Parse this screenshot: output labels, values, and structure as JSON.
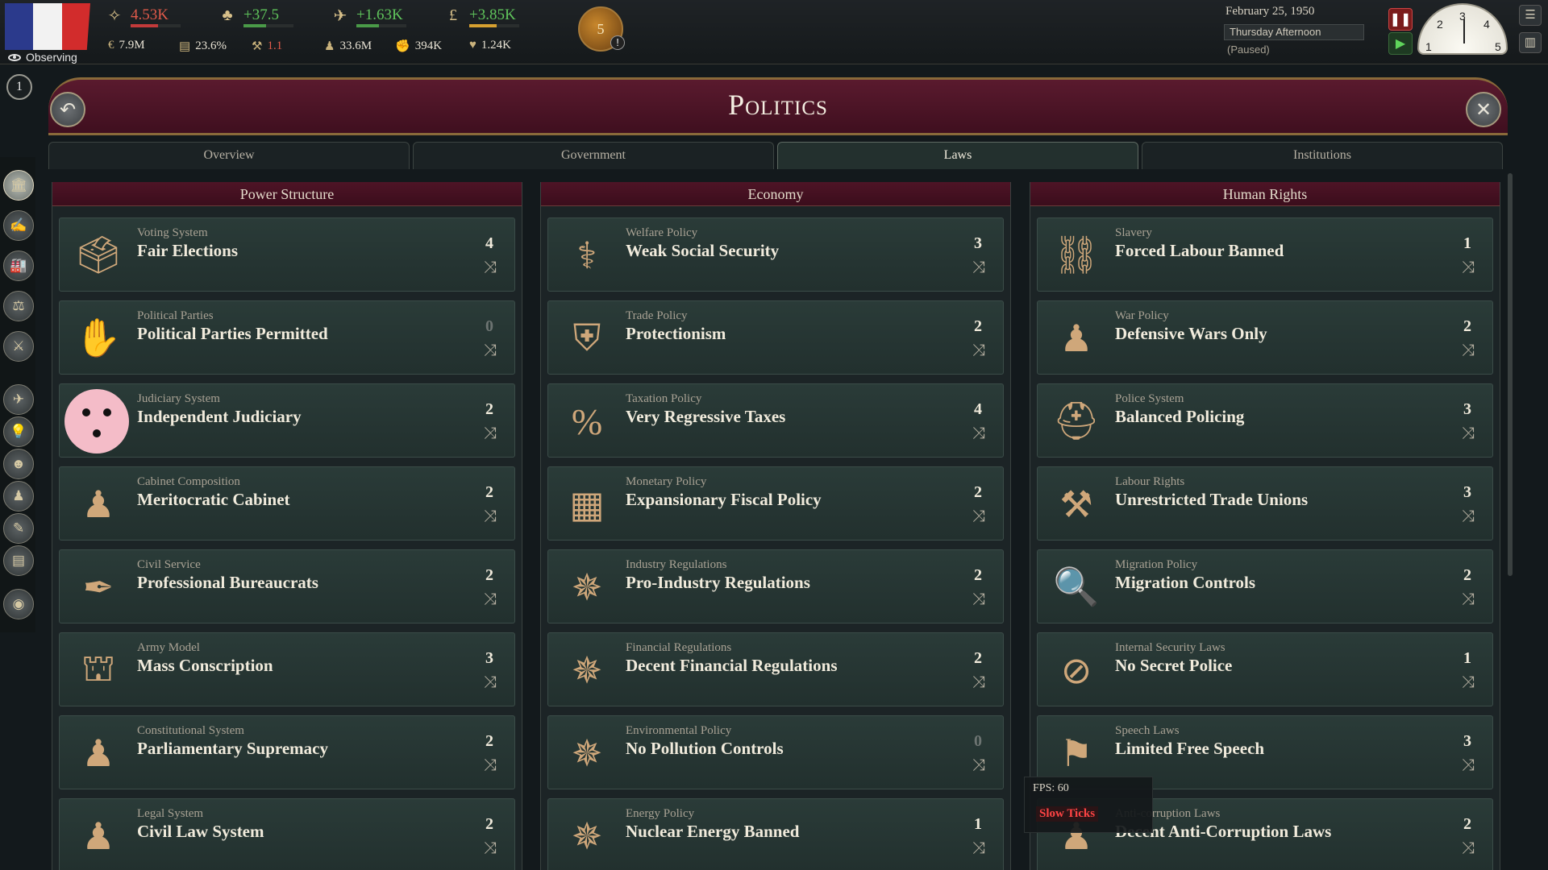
{
  "topbar": {
    "observing_label": "Observing",
    "resources": [
      {
        "icon": "authority-icon",
        "glyph": "✧",
        "value": "4.53K",
        "color": "#e05a4a",
        "bar_color": "#c23a3a",
        "bar_fill": 0.55
      },
      {
        "icon": "influence-icon",
        "glyph": "♣",
        "value": "+37.5",
        "color": "#5fc45b",
        "bar_color": "#4a9a48",
        "bar_fill": 0.45
      },
      {
        "icon": "bureaucracy-icon",
        "glyph": "✈",
        "value": "+1.63K",
        "color": "#5fc45b",
        "bar_color": "#4a9a48",
        "bar_fill": 0.45
      },
      {
        "icon": "money-icon",
        "glyph": "£",
        "value": "+3.85K",
        "color": "#5fc45b",
        "bar_color": "#d6a030",
        "bar_fill": 0.55
      }
    ],
    "stats": [
      {
        "icon": "gdp-icon",
        "glyph": "€",
        "value": "7.9M",
        "color": "#e8e2d4"
      },
      {
        "icon": "literacy-icon",
        "glyph": "▤",
        "value": "23.6%",
        "color": "#e8e2d4"
      },
      {
        "icon": "radicals-icon",
        "glyph": "⚒",
        "value": "1.1",
        "color": "#e05a4a"
      },
      {
        "icon": "population-icon",
        "glyph": "♟",
        "value": "33.6M",
        "color": "#e8e2d4"
      },
      {
        "icon": "army-icon",
        "glyph": "✊",
        "value": "394K",
        "color": "#e8e2d4"
      },
      {
        "icon": "loyalists-icon",
        "glyph": "♥",
        "value": "1.24K",
        "color": "#e8e2d4"
      }
    ],
    "medal_value": "5",
    "medal_warning": "!",
    "date": "February 25, 1950",
    "daytime": "Thursday Afternoon",
    "status": "(Paused)",
    "clock_numbers": [
      "1",
      "2",
      "3",
      "4",
      "5"
    ],
    "notification_count": "1"
  },
  "page": {
    "title": "Politics",
    "back_icon": "↶",
    "close_icon": "✕"
  },
  "tabs": [
    {
      "label": "Overview",
      "active": false
    },
    {
      "label": "Government",
      "active": false
    },
    {
      "label": "Laws",
      "active": true
    },
    {
      "label": "Institutions",
      "active": false
    }
  ],
  "sidebar_icons": [
    {
      "name": "government-icon",
      "glyph": "🏛"
    },
    {
      "name": "diplomacy-icon",
      "glyph": "✍"
    },
    {
      "name": "industry-icon",
      "glyph": "🏭"
    },
    {
      "name": "market-icon",
      "glyph": "⚖"
    },
    {
      "name": "military-icon",
      "glyph": "⚔"
    },
    {
      "name": "birds-icon",
      "glyph": "✈"
    },
    {
      "name": "research-icon",
      "glyph": "💡"
    },
    {
      "name": "culture-icon",
      "glyph": "☻"
    },
    {
      "name": "population-icon",
      "glyph": "♟"
    },
    {
      "name": "budget-icon",
      "glyph": "✎"
    },
    {
      "name": "journal-icon",
      "glyph": "▤"
    },
    {
      "name": "globe-icon",
      "glyph": "◉"
    }
  ],
  "columns": [
    {
      "title": "Power Structure",
      "laws": [
        {
          "category": "Voting System",
          "name": "Fair Elections",
          "value": "4",
          "icon": "ballot-box-icon",
          "glyph": "🗳"
        },
        {
          "category": "Political Parties",
          "name": "Political Parties Permitted",
          "value": "0",
          "icon": "gauntlet-icon",
          "glyph": "✋"
        },
        {
          "category": "Judiciary System",
          "name": "Independent Judiciary",
          "value": "2",
          "icon": "pink-face-icon",
          "glyph": ""
        },
        {
          "category": "Cabinet Composition",
          "name": "Meritocratic Cabinet",
          "value": "2",
          "icon": "officer-icon",
          "glyph": "♟"
        },
        {
          "category": "Civil Service",
          "name": "Professional Bureaucrats",
          "value": "2",
          "icon": "desk-icon",
          "glyph": "✒"
        },
        {
          "category": "Army Model",
          "name": "Mass Conscription",
          "value": "3",
          "icon": "barracks-icon",
          "glyph": "⛫"
        },
        {
          "category": "Constitutional System",
          "name": "Parliamentary Supremacy",
          "value": "2",
          "icon": "officer-icon",
          "glyph": "♟"
        },
        {
          "category": "Legal System",
          "name": "Civil Law System",
          "value": "2",
          "icon": "officer-icon",
          "glyph": "♟"
        }
      ]
    },
    {
      "title": "Economy",
      "laws": [
        {
          "category": "Welfare Policy",
          "name": "Weak Social Security",
          "value": "3",
          "icon": "crutch-icon",
          "glyph": "⚕"
        },
        {
          "category": "Trade Policy",
          "name": "Protectionism",
          "value": "2",
          "icon": "shield-factory-icon",
          "glyph": "⛨"
        },
        {
          "category": "Taxation Policy",
          "name": "Very Regressive Taxes",
          "value": "4",
          "icon": "percent-icon",
          "glyph": "%"
        },
        {
          "category": "Monetary Policy",
          "name": "Expansionary Fiscal Policy",
          "value": "2",
          "icon": "crates-icon",
          "glyph": "▦"
        },
        {
          "category": "Industry Regulations",
          "name": "Pro-Industry Regulations",
          "value": "2",
          "icon": "wheat-icon",
          "glyph": "✵"
        },
        {
          "category": "Financial Regulations",
          "name": "Decent Financial Regulations",
          "value": "2",
          "icon": "wheat-icon",
          "glyph": "✵"
        },
        {
          "category": "Environmental Policy",
          "name": "No Pollution Controls",
          "value": "0",
          "icon": "wheat-icon",
          "glyph": "✵"
        },
        {
          "category": "Energy Policy",
          "name": "Nuclear Energy Banned",
          "value": "1",
          "icon": "wheat-icon",
          "glyph": "✵"
        }
      ]
    },
    {
      "title": "Human Rights",
      "laws": [
        {
          "category": "Slavery",
          "name": "Forced Labour Banned",
          "value": "1",
          "icon": "broken-chain-icon",
          "glyph": "⛓"
        },
        {
          "category": "War Policy",
          "name": "Defensive Wars Only",
          "value": "2",
          "icon": "officer-icon",
          "glyph": "♟"
        },
        {
          "category": "Police System",
          "name": "Balanced Policing",
          "value": "3",
          "icon": "police-helmet-icon",
          "glyph": "⛑"
        },
        {
          "category": "Labour Rights",
          "name": "Unrestricted Trade Unions",
          "value": "3",
          "icon": "hammers-shield-icon",
          "glyph": "⚒"
        },
        {
          "category": "Migration Policy",
          "name": "Migration Controls",
          "value": "2",
          "icon": "inspector-icon",
          "glyph": "🔍"
        },
        {
          "category": "Internal Security Laws",
          "name": "No Secret Police",
          "value": "1",
          "icon": "banned-building-icon",
          "glyph": "⊘"
        },
        {
          "category": "Speech Laws",
          "name": "Limited Free Speech",
          "value": "3",
          "icon": "placards-icon",
          "glyph": "⚑"
        },
        {
          "category": "Anti-corruption Laws",
          "name": "Decent Anti-Corruption Laws",
          "value": "2",
          "icon": "officer-icon",
          "glyph": "♟"
        }
      ]
    }
  ],
  "debug": {
    "fps": "FPS: 60",
    "slow_ticks": "Slow Ticks"
  }
}
